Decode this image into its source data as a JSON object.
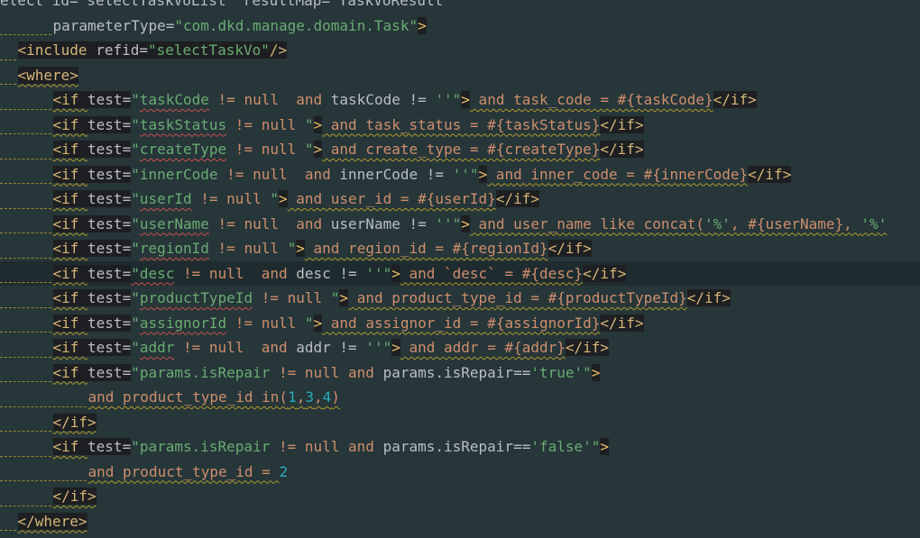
{
  "editor": {
    "lines": [
      {
        "indent": 0,
        "current": false,
        "tokens": [
          {
            "t": "elect id=\"selectTaskVoList\" resultMap=\"TaskVoResult\"",
            "c": "plain"
          }
        ]
      },
      {
        "indent": 3,
        "current": false,
        "tokens": [
          {
            "t": "parameterType=",
            "c": "attr"
          },
          {
            "t": "\"com.dkd.manage.domain.Task\"",
            "c": "str"
          },
          {
            "t": ">",
            "c": "br",
            "bg": true
          }
        ]
      },
      {
        "indent": 1,
        "current": false,
        "tokens": [
          {
            "t": "<include ",
            "c": "tag",
            "bg": true
          },
          {
            "t": "refid=",
            "c": "attr",
            "bg": true
          },
          {
            "t": "\"selectTaskVo\"",
            "c": "str",
            "bg": true
          },
          {
            "t": "/>",
            "c": "tag",
            "bg": true
          }
        ]
      },
      {
        "indent": 1,
        "current": false,
        "tokens": [
          {
            "t": "<where>",
            "c": "tag",
            "bg": true,
            "u": "y"
          }
        ]
      },
      {
        "indent": 3,
        "current": false,
        "tokens": [
          {
            "t": "<if ",
            "c": "tag",
            "bg": true,
            "u": "y"
          },
          {
            "t": "test=",
            "c": "attr",
            "bg": true
          },
          {
            "t": "\"",
            "c": "str"
          },
          {
            "t": "taskCode",
            "c": "str",
            "u": "r"
          },
          {
            "t": " != null  ",
            "c": "kw"
          },
          {
            "t": "and",
            "c": "kw"
          },
          {
            "t": " taskCode != ",
            "c": "plain"
          },
          {
            "t": "''",
            "c": "str"
          },
          {
            "t": "\"",
            "c": "str"
          },
          {
            "t": ">",
            "c": "br",
            "bg": true
          },
          {
            "t": " and task_code = #{taskCode}",
            "c": "kw",
            "u": "y"
          },
          {
            "t": "</if>",
            "c": "tag",
            "bg": true
          }
        ]
      },
      {
        "indent": 3,
        "current": false,
        "tokens": [
          {
            "t": "<if ",
            "c": "tag",
            "bg": true,
            "u": "y"
          },
          {
            "t": "test=",
            "c": "attr",
            "bg": true
          },
          {
            "t": "\"",
            "c": "str"
          },
          {
            "t": "taskStatus",
            "c": "str",
            "u": "r"
          },
          {
            "t": " != null ",
            "c": "kw"
          },
          {
            "t": "\"",
            "c": "str"
          },
          {
            "t": ">",
            "c": "br",
            "bg": true
          },
          {
            "t": " and task_status = #{taskStatus}",
            "c": "kw",
            "u": "y"
          },
          {
            "t": "</if>",
            "c": "tag",
            "bg": true
          }
        ]
      },
      {
        "indent": 3,
        "current": false,
        "tokens": [
          {
            "t": "<if ",
            "c": "tag",
            "bg": true,
            "u": "y"
          },
          {
            "t": "test=",
            "c": "attr",
            "bg": true
          },
          {
            "t": "\"",
            "c": "str"
          },
          {
            "t": "createType",
            "c": "str",
            "u": "r"
          },
          {
            "t": " != null ",
            "c": "kw"
          },
          {
            "t": "\"",
            "c": "str"
          },
          {
            "t": ">",
            "c": "br",
            "bg": true
          },
          {
            "t": " and create_type = #{createType}",
            "c": "kw",
            "u": "y"
          },
          {
            "t": "</if>",
            "c": "tag",
            "bg": true
          }
        ]
      },
      {
        "indent": 3,
        "current": false,
        "tokens": [
          {
            "t": "<if ",
            "c": "tag",
            "bg": true,
            "u": "y"
          },
          {
            "t": "test=",
            "c": "attr",
            "bg": true
          },
          {
            "t": "\"innerCode",
            "c": "str"
          },
          {
            "t": " != null  ",
            "c": "kw"
          },
          {
            "t": "and",
            "c": "kw"
          },
          {
            "t": " innerCode != ",
            "c": "plain"
          },
          {
            "t": "''",
            "c": "str"
          },
          {
            "t": "\"",
            "c": "str"
          },
          {
            "t": ">",
            "c": "br",
            "bg": true
          },
          {
            "t": " and inner_code = #{innerCode}",
            "c": "kw",
            "u": "y"
          },
          {
            "t": "</if>",
            "c": "tag",
            "bg": true
          }
        ]
      },
      {
        "indent": 3,
        "current": false,
        "tokens": [
          {
            "t": "<if ",
            "c": "tag",
            "bg": true,
            "u": "y"
          },
          {
            "t": "test=",
            "c": "attr",
            "bg": true
          },
          {
            "t": "\"",
            "c": "str"
          },
          {
            "t": "userId",
            "c": "str",
            "u": "r"
          },
          {
            "t": " != null ",
            "c": "kw"
          },
          {
            "t": "\"",
            "c": "str"
          },
          {
            "t": ">",
            "c": "br",
            "bg": true
          },
          {
            "t": " and user_id = #{userId}",
            "c": "kw",
            "u": "y"
          },
          {
            "t": "</if>",
            "c": "tag",
            "bg": true
          }
        ]
      },
      {
        "indent": 3,
        "current": false,
        "tokens": [
          {
            "t": "<if ",
            "c": "tag",
            "bg": true,
            "u": "y"
          },
          {
            "t": "test=",
            "c": "attr",
            "bg": true
          },
          {
            "t": "\"",
            "c": "str"
          },
          {
            "t": "userName",
            "c": "str",
            "u": "r"
          },
          {
            "t": " != null  ",
            "c": "kw"
          },
          {
            "t": "and",
            "c": "kw"
          },
          {
            "t": " userName != ",
            "c": "plain"
          },
          {
            "t": "''",
            "c": "str"
          },
          {
            "t": "\"",
            "c": "str"
          },
          {
            "t": ">",
            "c": "br",
            "bg": true
          },
          {
            "t": " and user_name like concat(",
            "c": "kw",
            "u": "y"
          },
          {
            "t": "'%'",
            "c": "str",
            "u": "y"
          },
          {
            "t": ", #{userName}, ",
            "c": "kw",
            "u": "y"
          },
          {
            "t": "'%'",
            "c": "str",
            "u": "y"
          }
        ]
      },
      {
        "indent": 3,
        "current": false,
        "tokens": [
          {
            "t": "<if ",
            "c": "tag",
            "bg": true,
            "u": "y"
          },
          {
            "t": "test=",
            "c": "attr",
            "bg": true
          },
          {
            "t": "\"",
            "c": "str"
          },
          {
            "t": "regionId",
            "c": "str",
            "u": "r"
          },
          {
            "t": " != null ",
            "c": "kw"
          },
          {
            "t": "\"",
            "c": "str"
          },
          {
            "t": ">",
            "c": "br",
            "bg": true
          },
          {
            "t": " and region_id = #{regionId}",
            "c": "kw",
            "u": "y"
          },
          {
            "t": "</if>",
            "c": "tag",
            "bg": true
          }
        ]
      },
      {
        "indent": 3,
        "current": true,
        "tokens": [
          {
            "t": "<if ",
            "c": "tag",
            "bg": true,
            "u": "y"
          },
          {
            "t": "test=",
            "c": "attr",
            "bg": true
          },
          {
            "t": "\"desc",
            "c": "str",
            "u": "r"
          },
          {
            "t": " != null  ",
            "c": "kw"
          },
          {
            "t": "and",
            "c": "kw"
          },
          {
            "t": " desc != ",
            "c": "plain"
          },
          {
            "t": "''",
            "c": "str"
          },
          {
            "t": "\"",
            "c": "str"
          },
          {
            "t": ">",
            "c": "br",
            "bg": true
          },
          {
            "t": " and `desc` = #{desc}",
            "c": "kw",
            "u": "y"
          },
          {
            "t": "</if>",
            "c": "tag",
            "bg": true
          }
        ]
      },
      {
        "indent": 3,
        "current": false,
        "tokens": [
          {
            "t": "<if ",
            "c": "tag",
            "bg": true,
            "u": "y"
          },
          {
            "t": "test=",
            "c": "attr",
            "bg": true
          },
          {
            "t": "\"",
            "c": "str"
          },
          {
            "t": "productTypeId",
            "c": "str",
            "u": "r"
          },
          {
            "t": " != null ",
            "c": "kw"
          },
          {
            "t": "\"",
            "c": "str"
          },
          {
            "t": ">",
            "c": "br",
            "bg": true
          },
          {
            "t": " and product_type_id = #{productTypeId}",
            "c": "kw",
            "u": "y"
          },
          {
            "t": "</if>",
            "c": "tag",
            "bg": true
          }
        ]
      },
      {
        "indent": 3,
        "current": false,
        "tokens": [
          {
            "t": "<if ",
            "c": "tag",
            "bg": true,
            "u": "y"
          },
          {
            "t": "test=",
            "c": "attr",
            "bg": true
          },
          {
            "t": "\"",
            "c": "str"
          },
          {
            "t": "assignorId",
            "c": "str",
            "u": "r"
          },
          {
            "t": " != null ",
            "c": "kw"
          },
          {
            "t": "\"",
            "c": "str"
          },
          {
            "t": ">",
            "c": "br",
            "bg": true
          },
          {
            "t": " and assignor_id = #{assignorId}",
            "c": "kw",
            "u": "y"
          },
          {
            "t": "</if>",
            "c": "tag",
            "bg": true
          }
        ]
      },
      {
        "indent": 3,
        "current": false,
        "tokens": [
          {
            "t": "<if ",
            "c": "tag",
            "bg": true,
            "u": "y"
          },
          {
            "t": "test=",
            "c": "attr",
            "bg": true
          },
          {
            "t": "\"",
            "c": "str"
          },
          {
            "t": "addr",
            "c": "str",
            "u": "r"
          },
          {
            "t": " != null  ",
            "c": "kw"
          },
          {
            "t": "and",
            "c": "kw"
          },
          {
            "t": " addr != ",
            "c": "plain"
          },
          {
            "t": "''",
            "c": "str"
          },
          {
            "t": "\"",
            "c": "str"
          },
          {
            "t": ">",
            "c": "br",
            "bg": true
          },
          {
            "t": " and addr = #{addr}",
            "c": "kw",
            "u": "y"
          },
          {
            "t": "</if>",
            "c": "tag",
            "bg": true
          }
        ]
      },
      {
        "indent": 3,
        "current": false,
        "tokens": [
          {
            "t": "<if ",
            "c": "tag",
            "bg": true,
            "u": "y"
          },
          {
            "t": "test=",
            "c": "attr",
            "bg": true
          },
          {
            "t": "\"params.isRepair",
            "c": "str"
          },
          {
            "t": " != null ",
            "c": "kw"
          },
          {
            "t": "and",
            "c": "kw"
          },
          {
            "t": " params.isRepair==",
            "c": "plain"
          },
          {
            "t": "'true'",
            "c": "str"
          },
          {
            "t": "\"",
            "c": "str"
          },
          {
            "t": ">",
            "c": "br",
            "bg": true
          }
        ]
      },
      {
        "indent": 5,
        "current": false,
        "tokens": [
          {
            "t": "and",
            "c": "kw",
            "u": "y"
          },
          {
            "t": " product_type_id in(",
            "c": "kw",
            "u": "y"
          },
          {
            "t": "1",
            "c": "num",
            "u": "y"
          },
          {
            "t": ",",
            "c": "kw",
            "u": "y"
          },
          {
            "t": "3",
            "c": "num",
            "u": "y"
          },
          {
            "t": ",",
            "c": "kw",
            "u": "y"
          },
          {
            "t": "4",
            "c": "num",
            "u": "y"
          },
          {
            "t": ")",
            "c": "kw",
            "u": "y"
          }
        ]
      },
      {
        "indent": 3,
        "current": false,
        "tokens": [
          {
            "t": "</if>",
            "c": "tag",
            "bg": true,
            "u": "y"
          }
        ]
      },
      {
        "indent": 3,
        "current": false,
        "tokens": [
          {
            "t": "<if ",
            "c": "tag",
            "bg": true,
            "u": "y"
          },
          {
            "t": "test=",
            "c": "attr",
            "bg": true
          },
          {
            "t": "\"params.isRepair",
            "c": "str"
          },
          {
            "t": " != null ",
            "c": "kw"
          },
          {
            "t": "and",
            "c": "kw"
          },
          {
            "t": " params.isRepair==",
            "c": "plain"
          },
          {
            "t": "'false'",
            "c": "str"
          },
          {
            "t": "\"",
            "c": "str"
          },
          {
            "t": ">",
            "c": "br",
            "bg": true
          }
        ]
      },
      {
        "indent": 5,
        "current": false,
        "tokens": [
          {
            "t": "and",
            "c": "kw",
            "u": "y"
          },
          {
            "t": " product_type_id = ",
            "c": "kw",
            "u": "y"
          },
          {
            "t": "2",
            "c": "num"
          }
        ]
      },
      {
        "indent": 3,
        "current": false,
        "tokens": [
          {
            "t": "</if>",
            "c": "tag",
            "bg": true,
            "u": "y"
          }
        ]
      },
      {
        "indent": 1,
        "current": false,
        "tokens": [
          {
            "t": "</where>",
            "c": "tag",
            "bg": true,
            "u": "y"
          }
        ]
      }
    ]
  }
}
